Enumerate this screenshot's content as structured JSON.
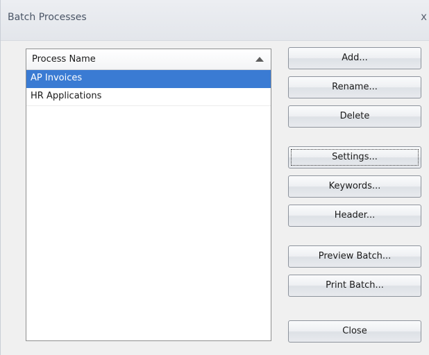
{
  "window": {
    "title": "Batch Processes",
    "close_glyph": "x"
  },
  "list": {
    "column_header": "Process Name",
    "sort_direction": "ascending",
    "rows": [
      {
        "label": "AP Invoices",
        "selected": true
      },
      {
        "label": "HR Applications",
        "selected": false
      }
    ]
  },
  "buttons": {
    "add": "Add...",
    "rename": "Rename...",
    "delete": "Delete",
    "settings": "Settings...",
    "keywords": "Keywords...",
    "header": "Header...",
    "preview_batch": "Preview Batch...",
    "print_batch": "Print Batch...",
    "close": "Close"
  },
  "colors": {
    "selection": "#3a7bd3",
    "dialog_bg": "#f0f0f0",
    "title_text": "#4a5566"
  }
}
